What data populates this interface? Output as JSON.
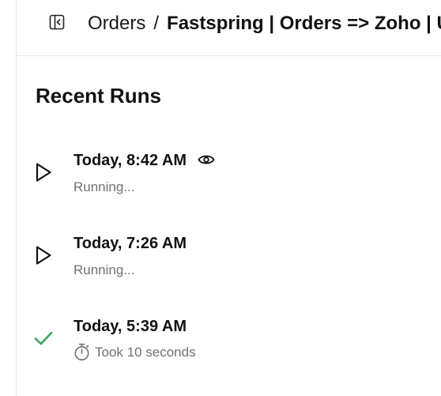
{
  "header": {
    "breadcrumb_root": "Orders",
    "breadcrumb_separator": "/",
    "breadcrumb_current": "Fastspring | Orders => Zoho | U"
  },
  "section": {
    "title": "Recent Runs"
  },
  "runs": [
    {
      "time": "Today, 8:42 AM",
      "status_text": "Running...",
      "status": "running",
      "has_view_icon": true
    },
    {
      "time": "Today, 7:26 AM",
      "status_text": "Running...",
      "status": "running",
      "has_view_icon": false
    },
    {
      "time": "Today, 5:39 AM",
      "status_text": "Took 10 seconds",
      "status": "success",
      "has_view_icon": false
    }
  ],
  "colors": {
    "success": "#3aa55d",
    "muted_text": "#707070"
  },
  "icons": {
    "sidebar_toggle": "sidebar-toggle-icon",
    "running": "play-icon",
    "success": "checkmark-icon",
    "view": "eye-icon",
    "duration": "stopwatch-icon"
  }
}
